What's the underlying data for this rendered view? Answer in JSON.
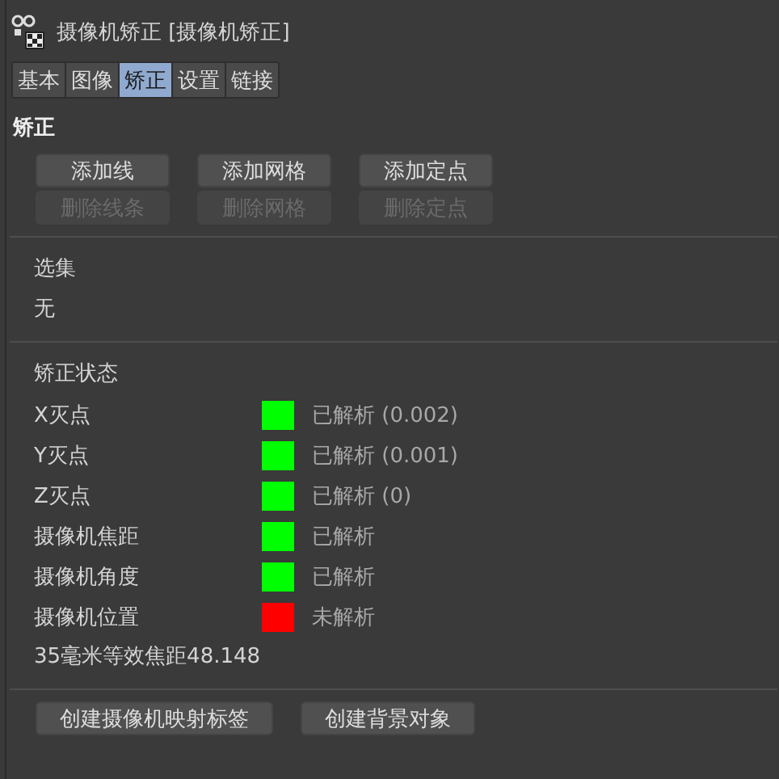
{
  "window": {
    "title": "摄像机矫正 [摄像机矫正]"
  },
  "tabs": [
    {
      "label": "基本",
      "selected": false
    },
    {
      "label": "图像",
      "selected": false
    },
    {
      "label": "矫正",
      "selected": true
    },
    {
      "label": "设置",
      "selected": false
    },
    {
      "label": "链接",
      "selected": false
    }
  ],
  "section_title": "矫正",
  "add_buttons": [
    {
      "label": "添加线",
      "disabled": false
    },
    {
      "label": "添加网格",
      "disabled": false
    },
    {
      "label": "添加定点",
      "disabled": false
    }
  ],
  "delete_buttons": [
    {
      "label": "删除线条",
      "disabled": true
    },
    {
      "label": "删除网格",
      "disabled": true
    },
    {
      "label": "删除定点",
      "disabled": true
    }
  ],
  "selection": {
    "label": "选集",
    "value": "无"
  },
  "status": {
    "label": "矫正状态",
    "rows": [
      {
        "name": "X灭点",
        "color": "#00ff00",
        "state": "已解析 (0.002)"
      },
      {
        "name": "Y灭点",
        "color": "#00ff00",
        "state": "已解析 (0.001)"
      },
      {
        "name": "Z灭点",
        "color": "#00ff00",
        "state": "已解析 (0)"
      },
      {
        "name": "摄像机焦距",
        "color": "#00ff00",
        "state": "已解析"
      },
      {
        "name": "摄像机角度",
        "color": "#00ff00",
        "state": "已解析"
      },
      {
        "name": "摄像机位置",
        "color": "#ff0000",
        "state": "未解析"
      }
    ]
  },
  "focal_text": "35毫米等效焦距48.148",
  "bottom_buttons": [
    {
      "label": "创建摄像机映射标签",
      "disabled": false
    },
    {
      "label": "创建背景对象",
      "disabled": false
    }
  ]
}
